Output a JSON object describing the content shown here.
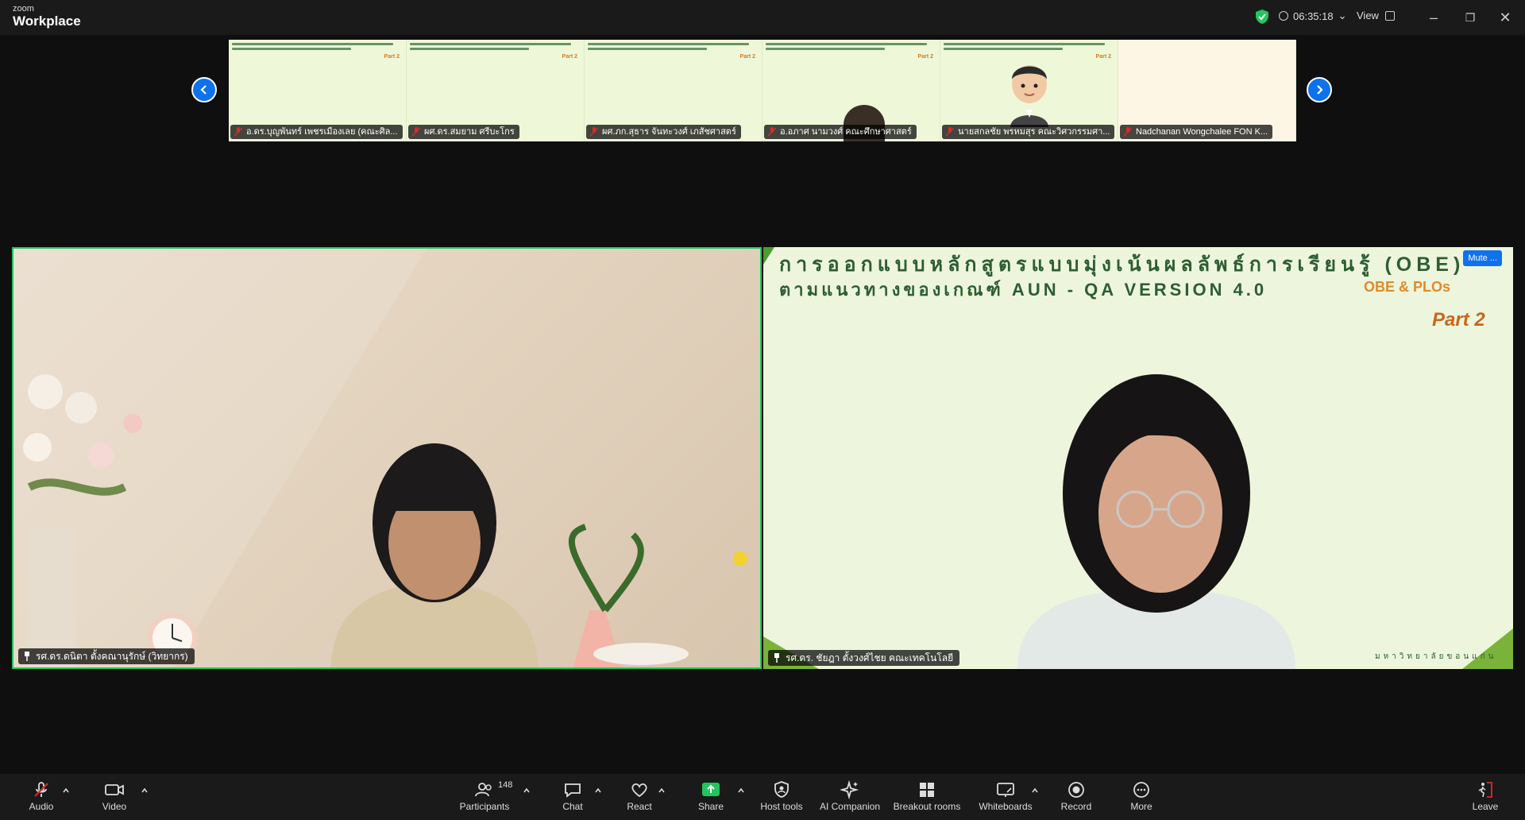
{
  "app": {
    "brand_top": "zoom",
    "brand_name": "Workplace"
  },
  "topbar": {
    "timer": "06:35:18",
    "view_label": "View"
  },
  "thumbnails": [
    {
      "name": "อ.ดร.บุญพันทร์ เพชรเมืองเลย (คณะศิล..."
    },
    {
      "name": "ผศ.ดร.สมยาม ศรีบะโกร"
    },
    {
      "name": "ผศ.ภก.สุธาร จันทะวงศ์ เภสัชศาสตร์"
    },
    {
      "name": "อ.อภาศ นามวงศ์ คณะศึกษาศาสตร์"
    },
    {
      "name": "นายสกลชัย พรหมสุร คณะวิศวกรรมศา..."
    },
    {
      "name": "Nadchanan Wongchalee FON K..."
    }
  ],
  "main": {
    "left_name": "รศ.ดร.ดนิตา ตั้งคณานุรักษ์ (วิทยากร)",
    "right_name": "รศ.ดร. ชัยฎา ตั้งวงศ์ไชย คณะเทคโนโลยี",
    "slide_title_1": "การออกแบบหลักสูตรแบบมุ่งเน้นผลลัพธ์การเรียนรู้ (OBE)",
    "slide_title_2": "ตามแนวทางของเกณฑ์ AUN - QA VERSION 4.0",
    "slide_tag": "OBE & PLOs",
    "slide_part": "Part 2",
    "slide_footer": "มหาวิทยาลัยขอนแก่น",
    "mute_badge": "Mute ..."
  },
  "toolbar": {
    "audio": "Audio",
    "video": "Video",
    "participants": "Participants",
    "participants_count": "148",
    "chat": "Chat",
    "react": "React",
    "share": "Share",
    "host_tools": "Host tools",
    "ai_companion": "AI Companion",
    "breakout_rooms": "Breakout rooms",
    "whiteboards": "Whiteboards",
    "record": "Record",
    "more": "More",
    "leave": "Leave"
  },
  "colors": {
    "accent": "#0e72ed",
    "active_speaker": "#22c55e",
    "share_green": "#22c55e",
    "leave_red": "#e02828"
  }
}
